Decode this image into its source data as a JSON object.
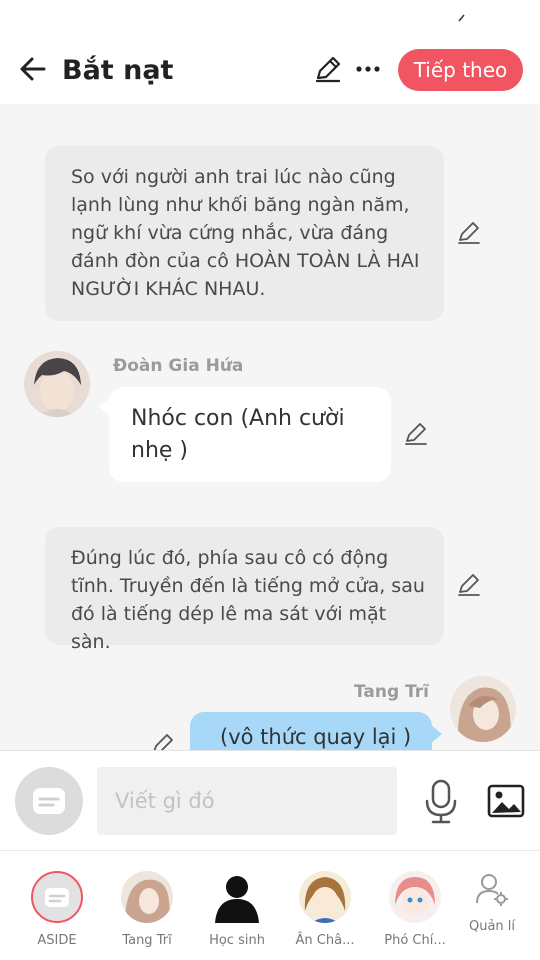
{
  "header": {
    "title": "Bắt nạt",
    "next_label": "Tiếp theo"
  },
  "chat": {
    "narration_1": "So với người anh trai lúc nào cũng lạnh lùng như khối băng ngàn năm, ngữ khí vừa cứng nhắc, vừa đáng đánh đòn của cô HOÀN TOÀN LÀ HAI NGƯỜI KHÁC NHAU.",
    "speaker_1": "Đoàn Gia Hứa",
    "message_1": "Nhóc con (Anh cười nhẹ )",
    "narration_2": "Đúng lúc đó, phía sau cô có động tĩnh. Truyền đến là tiếng mở cửa, sau đó là tiếng dép lê ma sát với mặt sàn.",
    "speaker_2": "Tang Trĩ",
    "message_2": "(vô thức quay lại )"
  },
  "input": {
    "placeholder": "Viết gì đó"
  },
  "characters": [
    {
      "label": "ASIDE"
    },
    {
      "label": "Tang Trĩ"
    },
    {
      "label": "Học sinh"
    },
    {
      "label": "Ân Châ..."
    },
    {
      "label": "Phó Chí..."
    },
    {
      "label": "Quản lí"
    }
  ],
  "colors": {
    "accent": "#f25562",
    "user_bubble": "#a7d8f7",
    "narration_bg": "#ebebeb"
  }
}
